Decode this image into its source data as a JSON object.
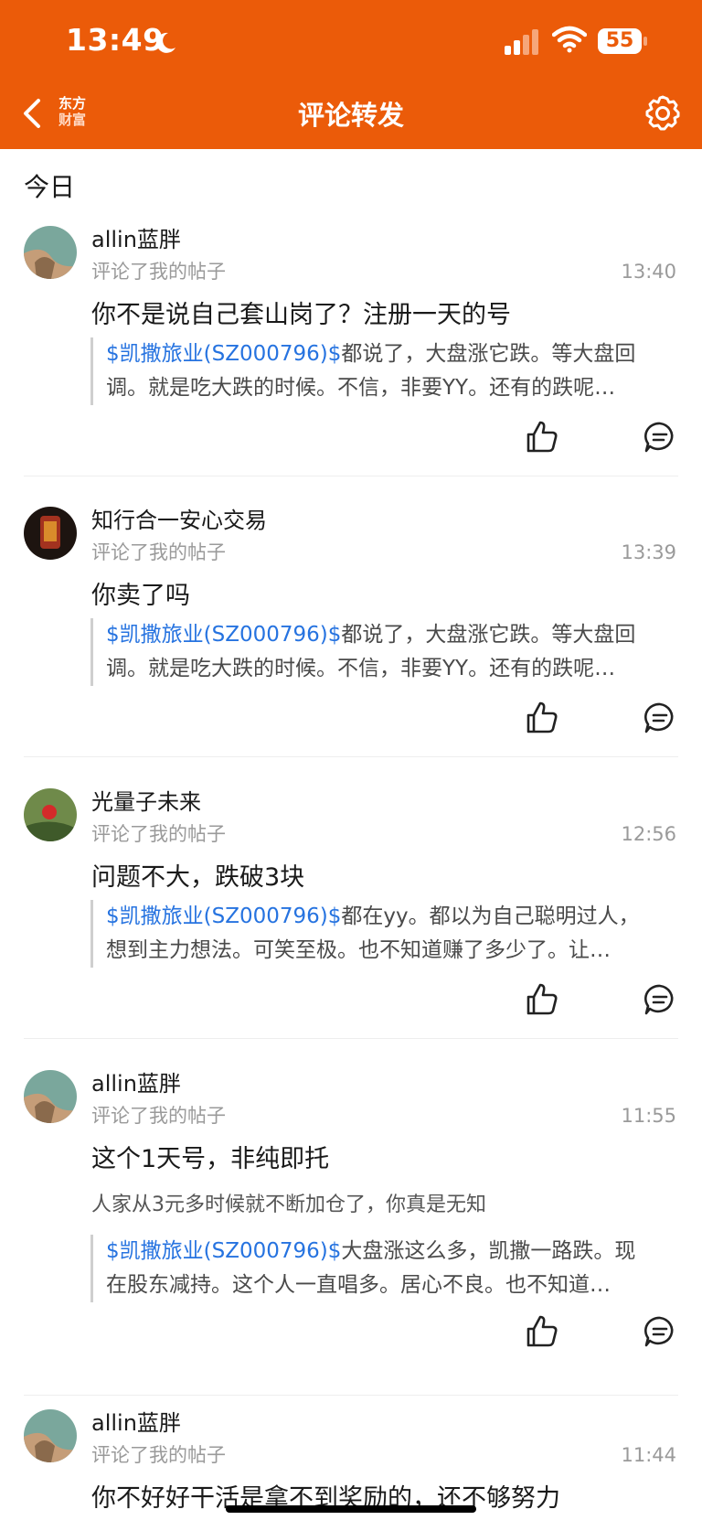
{
  "status_bar": {
    "time": "13:49",
    "battery": "55"
  },
  "header": {
    "title": "评论转发",
    "logo_line1": "东方",
    "logo_line2": "财富"
  },
  "section": {
    "label": "今日"
  },
  "colors": {
    "brand": "#EB5B09",
    "link": "#2673E0"
  },
  "items": [
    {
      "user": "allin蓝胖",
      "action": "评论了我的帖子",
      "time": "13:40",
      "comment": "你不是说自己套山岗了？注册一天的号",
      "quote_stock": "$凯撒旅业(SZ000796)$",
      "quote_line1": "都说了，大盘涨它跌。等大盘回",
      "quote_line2": "调。就是吃大跌的时候。不信，非要YY。还有的跌呢…"
    },
    {
      "user": "知行合一安心交易",
      "action": "评论了我的帖子",
      "time": "13:39",
      "comment": "你卖了吗",
      "quote_stock": "$凯撒旅业(SZ000796)$",
      "quote_line1": "都说了，大盘涨它跌。等大盘回",
      "quote_line2": "调。就是吃大跌的时候。不信，非要YY。还有的跌呢…"
    },
    {
      "user": "光量子未来",
      "action": "评论了我的帖子",
      "time": "12:56",
      "comment": "问题不大，跌破3块",
      "quote_stock": "$凯撒旅业(SZ000796)$",
      "quote_line1": "都在yy。都以为自己聪明过人，",
      "quote_line2": "想到主力想法。可笑至极。也不知道赚了多少了。让…"
    },
    {
      "user": "allin蓝胖",
      "action": "评论了我的帖子",
      "time": "11:55",
      "comment": "这个1天号，非纯即托",
      "subtext": "人家从3元多时候就不断加仓了，你真是无知",
      "quote_stock": "$凯撒旅业(SZ000796)$",
      "quote_line1": "大盘涨这么多，凯撒一路跌。现",
      "quote_line2": "在股东减持。这个人一直唱多。居心不良。也不知道…"
    },
    {
      "user": "allin蓝胖",
      "action": "评论了我的帖子",
      "time": "11:44",
      "comment": "你不好好干活是拿不到奖励的，还不够努力"
    }
  ]
}
